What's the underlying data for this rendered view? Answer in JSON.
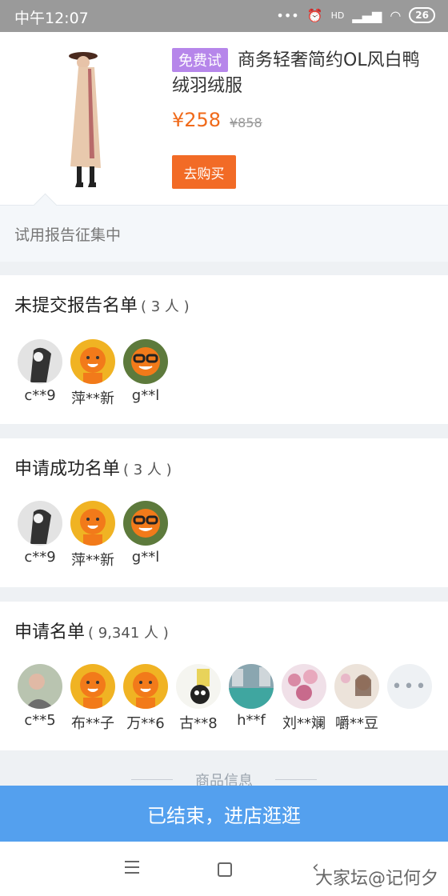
{
  "status_bar": {
    "time": "中午12:07",
    "signal_text": "•••",
    "network": "HD",
    "battery": "26"
  },
  "product": {
    "badge": "免费试",
    "title": "商务轻奢简约OL风白鸭绒羽绒服",
    "price": "¥258",
    "old_price": "¥858",
    "buy_label": "去购买"
  },
  "collect_text": "试用报告征集中",
  "sections": [
    {
      "title": "未提交报告名单",
      "count": "( 3 人 )",
      "users": [
        {
          "name": "c**9",
          "color": "#d9d9d9"
        },
        {
          "name": "萍**新",
          "color": "#f0b323"
        },
        {
          "name": "g**l",
          "color": "#f0b323"
        }
      ]
    },
    {
      "title": "申请成功名单",
      "count": "( 3 人 )",
      "users": [
        {
          "name": "c**9",
          "color": "#d9d9d9"
        },
        {
          "name": "萍**新",
          "color": "#f0b323"
        },
        {
          "name": "g**l",
          "color": "#f0b323"
        }
      ]
    },
    {
      "title": "申请名单",
      "count": "( 9,341 人 )",
      "users": [
        {
          "name": "c**5",
          "color": "#b9c4b0"
        },
        {
          "name": "布**子",
          "color": "#f0b323"
        },
        {
          "name": "万**6",
          "color": "#f0b323"
        },
        {
          "name": "古**8",
          "color": "#e8e2a0"
        },
        {
          "name": "h**f",
          "color": "#5a8fa0"
        },
        {
          "name": "刘**斓",
          "color": "#d9b5c2"
        },
        {
          "name": "嚼**豆",
          "color": "#e7d6c7"
        }
      ],
      "more_icon": "•••"
    }
  ],
  "info_label": "商品信息",
  "cta_label": "已结束，进店逛逛",
  "watermark": "大家坛@记何夕"
}
